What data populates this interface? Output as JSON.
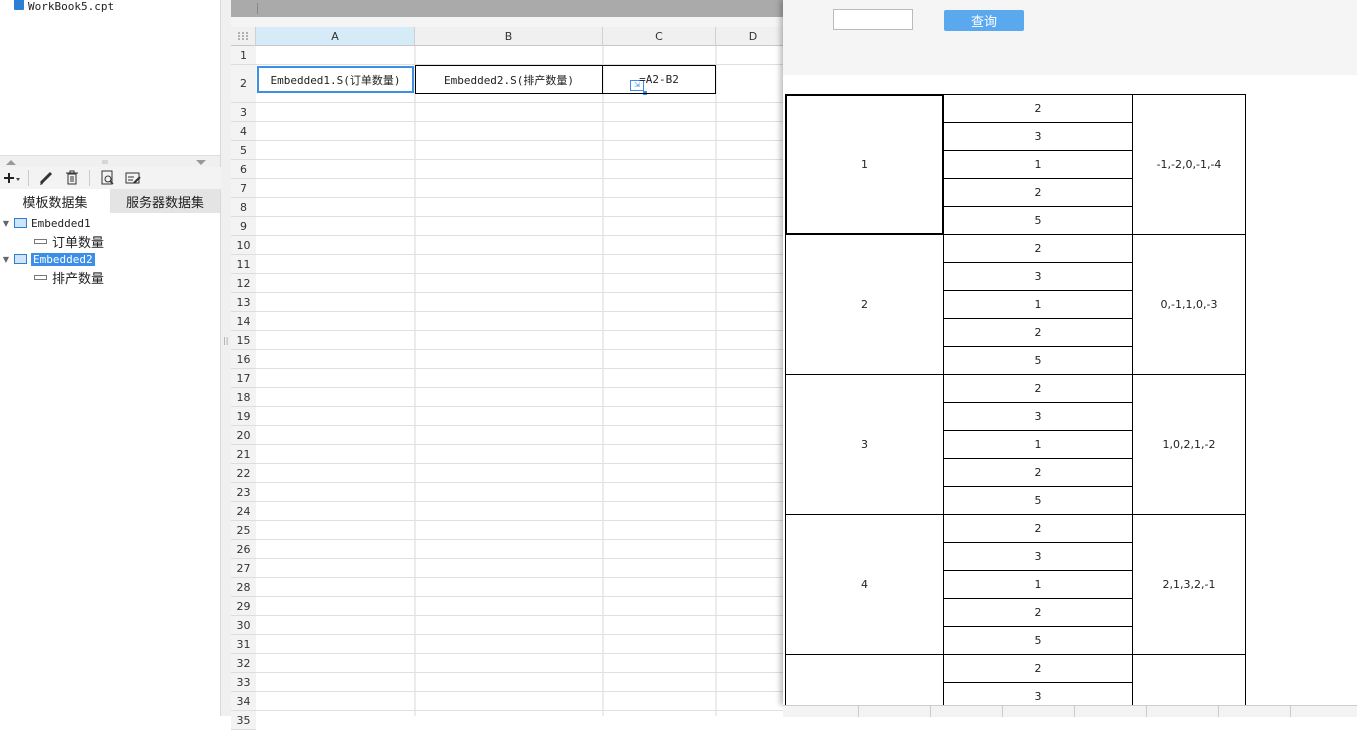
{
  "file": {
    "name": "WorkBook5.cpt",
    "icon": "report-file-icon"
  },
  "toolbar": {
    "icons": [
      "add-icon",
      "edit-icon",
      "delete-icon",
      "preview-icon",
      "edit-dataset-icon"
    ]
  },
  "dataset_tabs": [
    {
      "label": "模板数据集",
      "active": true
    },
    {
      "label": "服务器数据集",
      "active": false
    }
  ],
  "tree": {
    "ds1": {
      "name": "Embedded1",
      "field": "订单数量"
    },
    "ds2": {
      "name": "Embedded2",
      "field": "排产数量",
      "selected": true
    }
  },
  "sheet": {
    "columns": [
      "A",
      "B",
      "C",
      "D"
    ],
    "active_column": "A",
    "rows": [
      "1",
      "2",
      "3",
      "4",
      "5",
      "6",
      "7",
      "8",
      "9",
      "10",
      "11",
      "12",
      "13",
      "14",
      "15",
      "16",
      "17",
      "18",
      "19",
      "20",
      "21",
      "22",
      "23",
      "24",
      "25",
      "26",
      "27",
      "28",
      "29",
      "30",
      "31",
      "32",
      "33",
      "34",
      "35"
    ],
    "cells": {
      "A2": "Embedded1.S(订单数量)",
      "B2": "Embedded2.S(排产数量)",
      "C2": "=A2-B2"
    },
    "selected_cell": "A2"
  },
  "preview": {
    "param_input_value": "",
    "query_button": "查询",
    "groups": [
      {
        "a": "1",
        "b": [
          "2",
          "3",
          "1",
          "2",
          "5"
        ],
        "c": "-1,-2,0,-1,-4"
      },
      {
        "a": "2",
        "b": [
          "2",
          "3",
          "1",
          "2",
          "5"
        ],
        "c": "0,-1,1,0,-3"
      },
      {
        "a": "3",
        "b": [
          "2",
          "3",
          "1",
          "2",
          "5"
        ],
        "c": "1,0,2,1,-2"
      },
      {
        "a": "4",
        "b": [
          "2",
          "3",
          "1",
          "2",
          "5"
        ],
        "c": "2,1,3,2,-1"
      },
      {
        "a": "",
        "b": [
          "2",
          "3"
        ],
        "c": ""
      }
    ]
  },
  "colors": {
    "accent": "#3d8ee6",
    "query_button": "#5aa9ee",
    "active_col_header": "#d5ebf8"
  }
}
